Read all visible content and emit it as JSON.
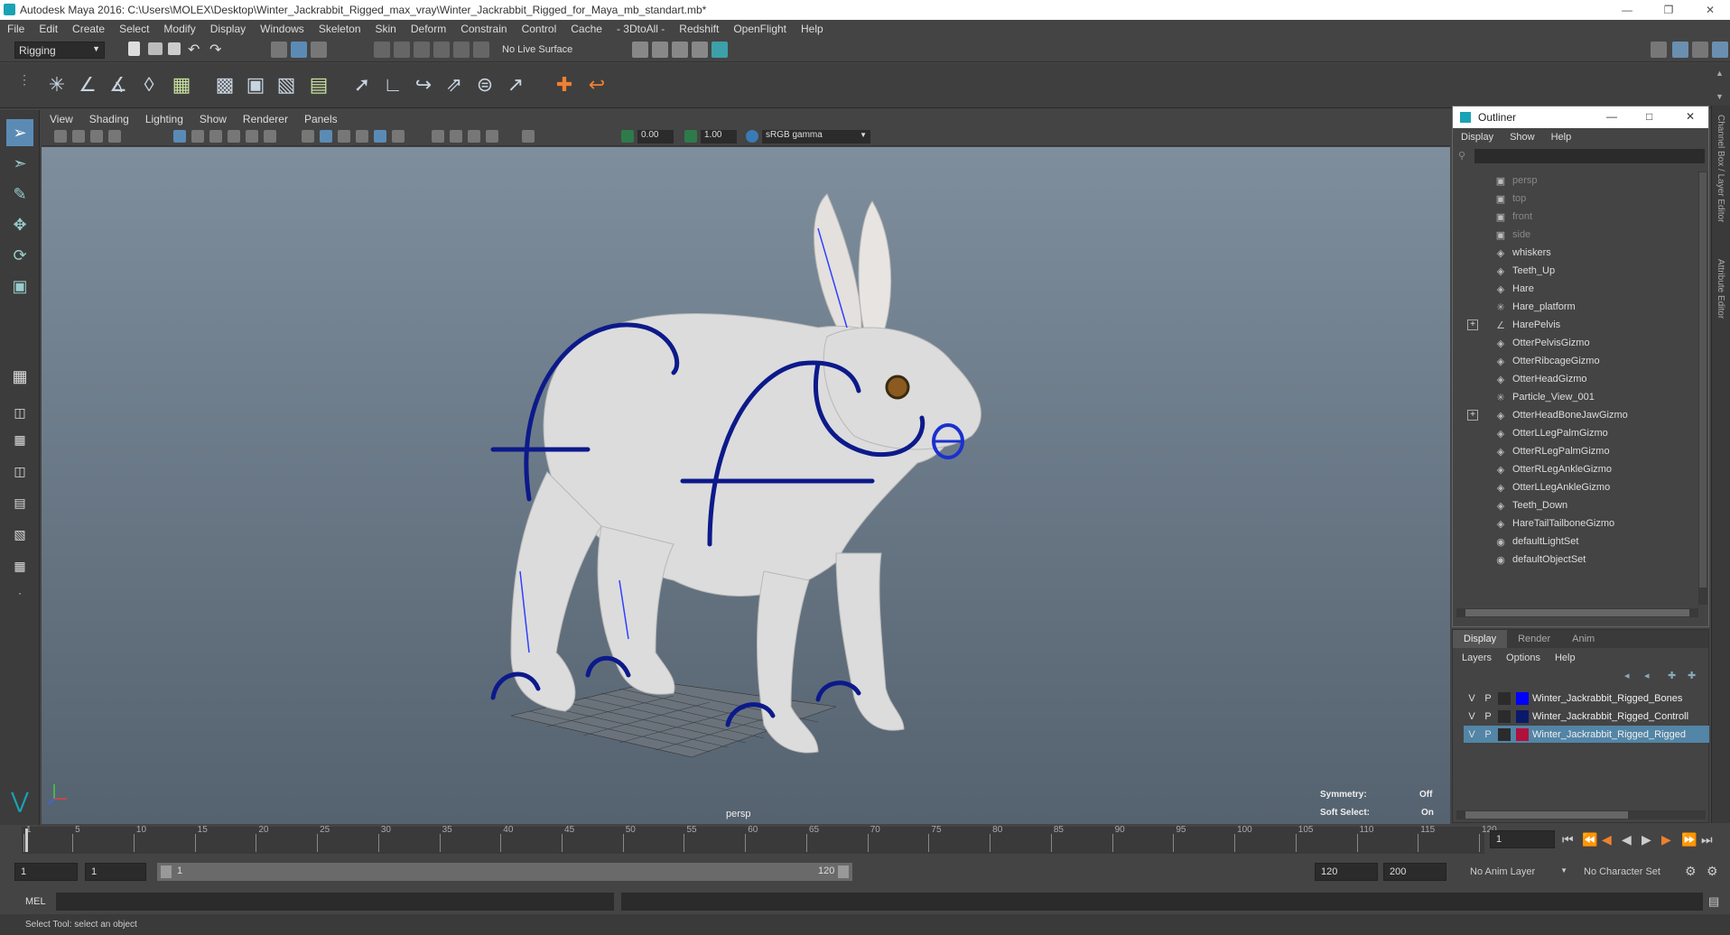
{
  "window": {
    "title": "Autodesk Maya 2016: C:\\Users\\MOLEX\\Desktop\\Winter_Jackrabbit_Rigged_max_vray\\Winter_Jackrabbit_Rigged_for_Maya_mb_standart.mb*"
  },
  "menubar": [
    "File",
    "Edit",
    "Create",
    "Select",
    "Modify",
    "Display",
    "Windows",
    "Skeleton",
    "Skin",
    "Deform",
    "Constrain",
    "Control",
    "Cache",
    "- 3DtoAll -",
    "Redshift",
    "OpenFlight",
    "Help"
  ],
  "statusline": {
    "mode": "Rigging",
    "live_surface": "No Live Surface"
  },
  "viewport": {
    "menu": [
      "View",
      "Shading",
      "Lighting",
      "Show",
      "Renderer",
      "Panels"
    ],
    "exposure": "0.00",
    "gamma": "1.00",
    "colorspace": "sRGB gamma",
    "camera_label": "persp",
    "symmetry_label": "Symmetry:",
    "symmetry_value": "Off",
    "soft_select_label": "Soft Select:",
    "soft_select_value": "On"
  },
  "outliner": {
    "title": "Outliner",
    "menu": [
      "Display",
      "Show",
      "Help"
    ],
    "items": [
      {
        "name": "persp",
        "icon": "camera-icon",
        "dim": true,
        "expand": false
      },
      {
        "name": "top",
        "icon": "camera-icon",
        "dim": true,
        "expand": false
      },
      {
        "name": "front",
        "icon": "camera-icon",
        "dim": true,
        "expand": false
      },
      {
        "name": "side",
        "icon": "camera-icon",
        "dim": true,
        "expand": false
      },
      {
        "name": "whiskers",
        "icon": "mesh-icon",
        "dim": false,
        "expand": false
      },
      {
        "name": "Teeth_Up",
        "icon": "mesh-icon",
        "dim": false,
        "expand": false
      },
      {
        "name": "Hare",
        "icon": "mesh-icon",
        "dim": false,
        "expand": false
      },
      {
        "name": "Hare_platform",
        "icon": "locator-icon",
        "dim": false,
        "expand": false
      },
      {
        "name": "HarePelvis",
        "icon": "joint-icon",
        "dim": false,
        "expand": true
      },
      {
        "name": "OtterPelvisGizmo",
        "icon": "mesh-icon",
        "dim": false,
        "expand": false
      },
      {
        "name": "OtterRibcageGizmo",
        "icon": "mesh-icon",
        "dim": false,
        "expand": false
      },
      {
        "name": "OtterHeadGizmo",
        "icon": "mesh-icon",
        "dim": false,
        "expand": false
      },
      {
        "name": "Particle_View_001",
        "icon": "locator-icon",
        "dim": false,
        "expand": false
      },
      {
        "name": "OtterHeadBoneJawGizmo",
        "icon": "mesh-icon",
        "dim": false,
        "expand": true
      },
      {
        "name": "OtterLLegPalmGizmo",
        "icon": "mesh-icon",
        "dim": false,
        "expand": false
      },
      {
        "name": "OtterRLegPalmGizmo",
        "icon": "mesh-icon",
        "dim": false,
        "expand": false
      },
      {
        "name": "OtterRLegAnkleGizmo",
        "icon": "mesh-icon",
        "dim": false,
        "expand": false
      },
      {
        "name": "OtterLLegAnkleGizmo",
        "icon": "mesh-icon",
        "dim": false,
        "expand": false
      },
      {
        "name": "Teeth_Down",
        "icon": "mesh-icon",
        "dim": false,
        "expand": false
      },
      {
        "name": "HareTailTailboneGizmo",
        "icon": "mesh-icon",
        "dim": false,
        "expand": false
      },
      {
        "name": "defaultLightSet",
        "icon": "set-icon",
        "dim": false,
        "expand": false
      },
      {
        "name": "defaultObjectSet",
        "icon": "set-icon",
        "dim": false,
        "expand": false
      }
    ]
  },
  "layer_editor": {
    "tabs": [
      "Display",
      "Render",
      "Anim"
    ],
    "menu": [
      "Layers",
      "Options",
      "Help"
    ],
    "layers": [
      {
        "v": "V",
        "p": "P",
        "color": "#0000ff",
        "name": "Winter_Jackrabbit_Rigged_Bones",
        "selected": false
      },
      {
        "v": "V",
        "p": "P",
        "color": "#0a1a6b",
        "name": "Winter_Jackrabbit_Rigged_Controll",
        "selected": false
      },
      {
        "v": "V",
        "p": "P",
        "color": "#b0103a",
        "name": "Winter_Jackrabbit_Rigged_Rigged",
        "selected": true
      }
    ]
  },
  "side_tabs": [
    "Channel Box / Layer Editor",
    "Attribute Editor"
  ],
  "timeline": {
    "ticks": [
      "1",
      "5",
      "10",
      "15",
      "20",
      "25",
      "30",
      "35",
      "40",
      "45",
      "50",
      "55",
      "60",
      "65",
      "70",
      "75",
      "80",
      "85",
      "90",
      "95",
      "100",
      "105",
      "110",
      "115",
      "120"
    ],
    "current_frame": "1"
  },
  "range": {
    "start": "1",
    "playback_start": "1",
    "slider_start": "1",
    "slider_end": "120",
    "playback_end": "120",
    "end": "200",
    "anim_layer": "No Anim Layer",
    "character_set": "No Character Set"
  },
  "cmdline": {
    "label": "MEL"
  },
  "helpline": {
    "text": "Select Tool: select an object"
  }
}
